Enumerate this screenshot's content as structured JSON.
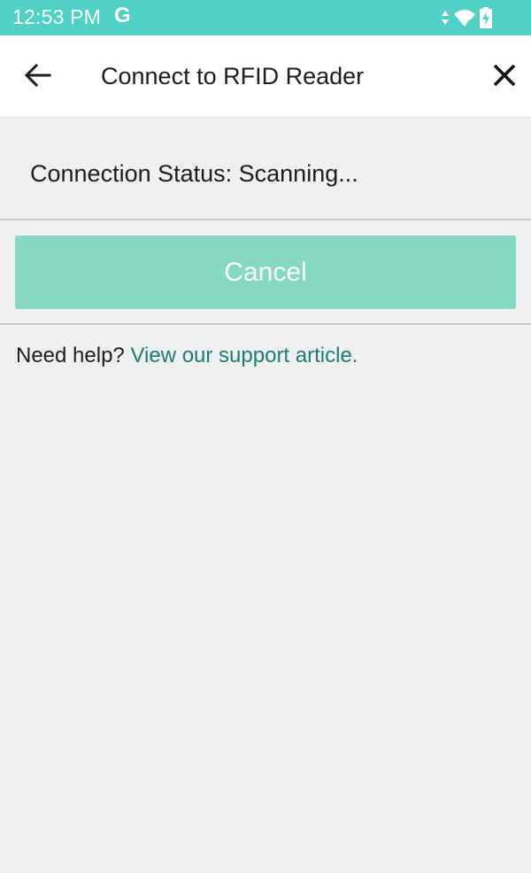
{
  "status_bar": {
    "time": "12:53 PM",
    "google_indicator": "G",
    "icons": [
      "data-arrows-icon",
      "wifi-icon",
      "battery-charging-icon"
    ],
    "background_color": "#4fd1c5"
  },
  "app_bar": {
    "back_icon": "arrow-left-icon",
    "title": "Connect to RFID Reader",
    "close_icon": "close-icon"
  },
  "connection": {
    "status_text": "Connection Status: Scanning..."
  },
  "actions": {
    "cancel_label": "Cancel",
    "cancel_color": "#85d8c2"
  },
  "help": {
    "prefix": "Need help? ",
    "link_text": "View our support article.",
    "link_color": "#1b7f6c"
  }
}
